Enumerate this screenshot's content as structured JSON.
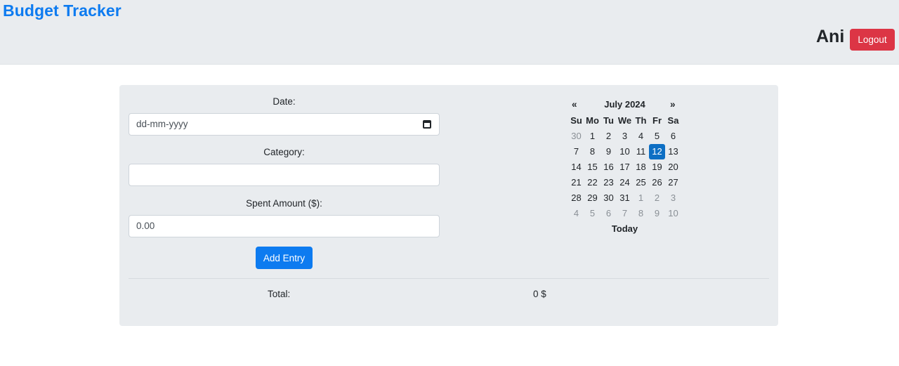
{
  "navbar": {
    "brand": "Budget Tracker",
    "username": "Ani",
    "logout_label": "Logout"
  },
  "form": {
    "date_label": "Date:",
    "date_placeholder": "dd-mm-yyyy",
    "category_label": "Category:",
    "category_value": "",
    "amount_label": "Spent Amount ($):",
    "amount_value": "0.00",
    "add_button": "Add Entry"
  },
  "summary": {
    "total_label": "Total:",
    "total_value": "0 $"
  },
  "calendar": {
    "prev": "«",
    "next": "»",
    "title": "July 2024",
    "weekdays": [
      "Su",
      "Mo",
      "Tu",
      "We",
      "Th",
      "Fr",
      "Sa"
    ],
    "weeks": [
      [
        "30",
        "1",
        "2",
        "3",
        "4",
        "5",
        "6"
      ],
      [
        "7",
        "8",
        "9",
        "10",
        "11",
        "12",
        "13"
      ],
      [
        "14",
        "15",
        "16",
        "17",
        "18",
        "19",
        "20"
      ],
      [
        "21",
        "22",
        "23",
        "24",
        "25",
        "26",
        "27"
      ],
      [
        "28",
        "29",
        "30",
        "31",
        "1",
        "2",
        "3"
      ],
      [
        "4",
        "5",
        "6",
        "7",
        "8",
        "9",
        "10"
      ]
    ],
    "other_month_cells": [
      "0-0",
      "4-4",
      "4-5",
      "4-6",
      "5-0",
      "5-1",
      "5-2",
      "5-3",
      "5-4",
      "5-5",
      "5-6"
    ],
    "selected_cell": "1-5",
    "today_label": "Today"
  },
  "colors": {
    "brand": "#0d7bf0",
    "logout": "#dc3545",
    "primary": "#0d7bf0",
    "selected_day": "#0d6fc4",
    "panel": "#e9ecef"
  }
}
